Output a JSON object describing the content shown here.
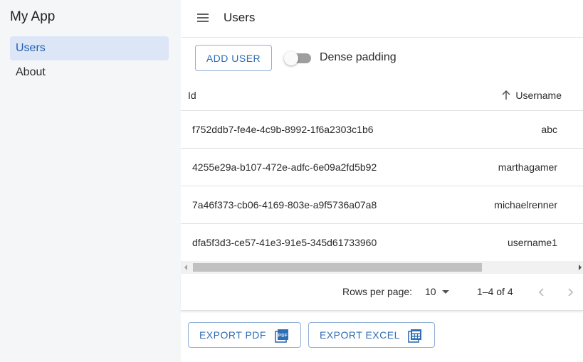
{
  "app": {
    "title": "My App"
  },
  "sidebar": {
    "items": [
      {
        "label": "Users",
        "active": true
      },
      {
        "label": "About",
        "active": false
      }
    ]
  },
  "header": {
    "title": "Users",
    "menu_icon": "menu-icon"
  },
  "toolbar": {
    "add_user_label": "ADD USER",
    "dense_label": "Dense padding",
    "dense_on": false
  },
  "table": {
    "columns": [
      {
        "label": "Id"
      },
      {
        "label": "Username",
        "sort": "ascending"
      }
    ],
    "rows": [
      {
        "id": "f752ddb7-fe4e-4c9b-8992-1f6a2303c1b6",
        "username": "abc"
      },
      {
        "id": "4255e29a-b107-472e-adfc-6e09a2fd5b92",
        "username": "marthagamer"
      },
      {
        "id": "7a46f373-cb06-4169-803e-a9f5736a07a8",
        "username": "michaelrenner"
      },
      {
        "id": "dfa5f3d3-ce57-41e3-91e5-345d61733960",
        "username": "username1"
      }
    ]
  },
  "pagination": {
    "rows_per_page_label": "Rows per page:",
    "rows_per_page": "10",
    "range": "1–4 of 4"
  },
  "export": {
    "pdf_label": "EXPORT PDF",
    "excel_label": "EXPORT EXCEL",
    "pdf_icon_text": "PDF"
  },
  "colors": {
    "accent": "#2f6db5",
    "active_nav_bg": "#dce6f7",
    "sidebar_bg": "#f5f6f8"
  }
}
